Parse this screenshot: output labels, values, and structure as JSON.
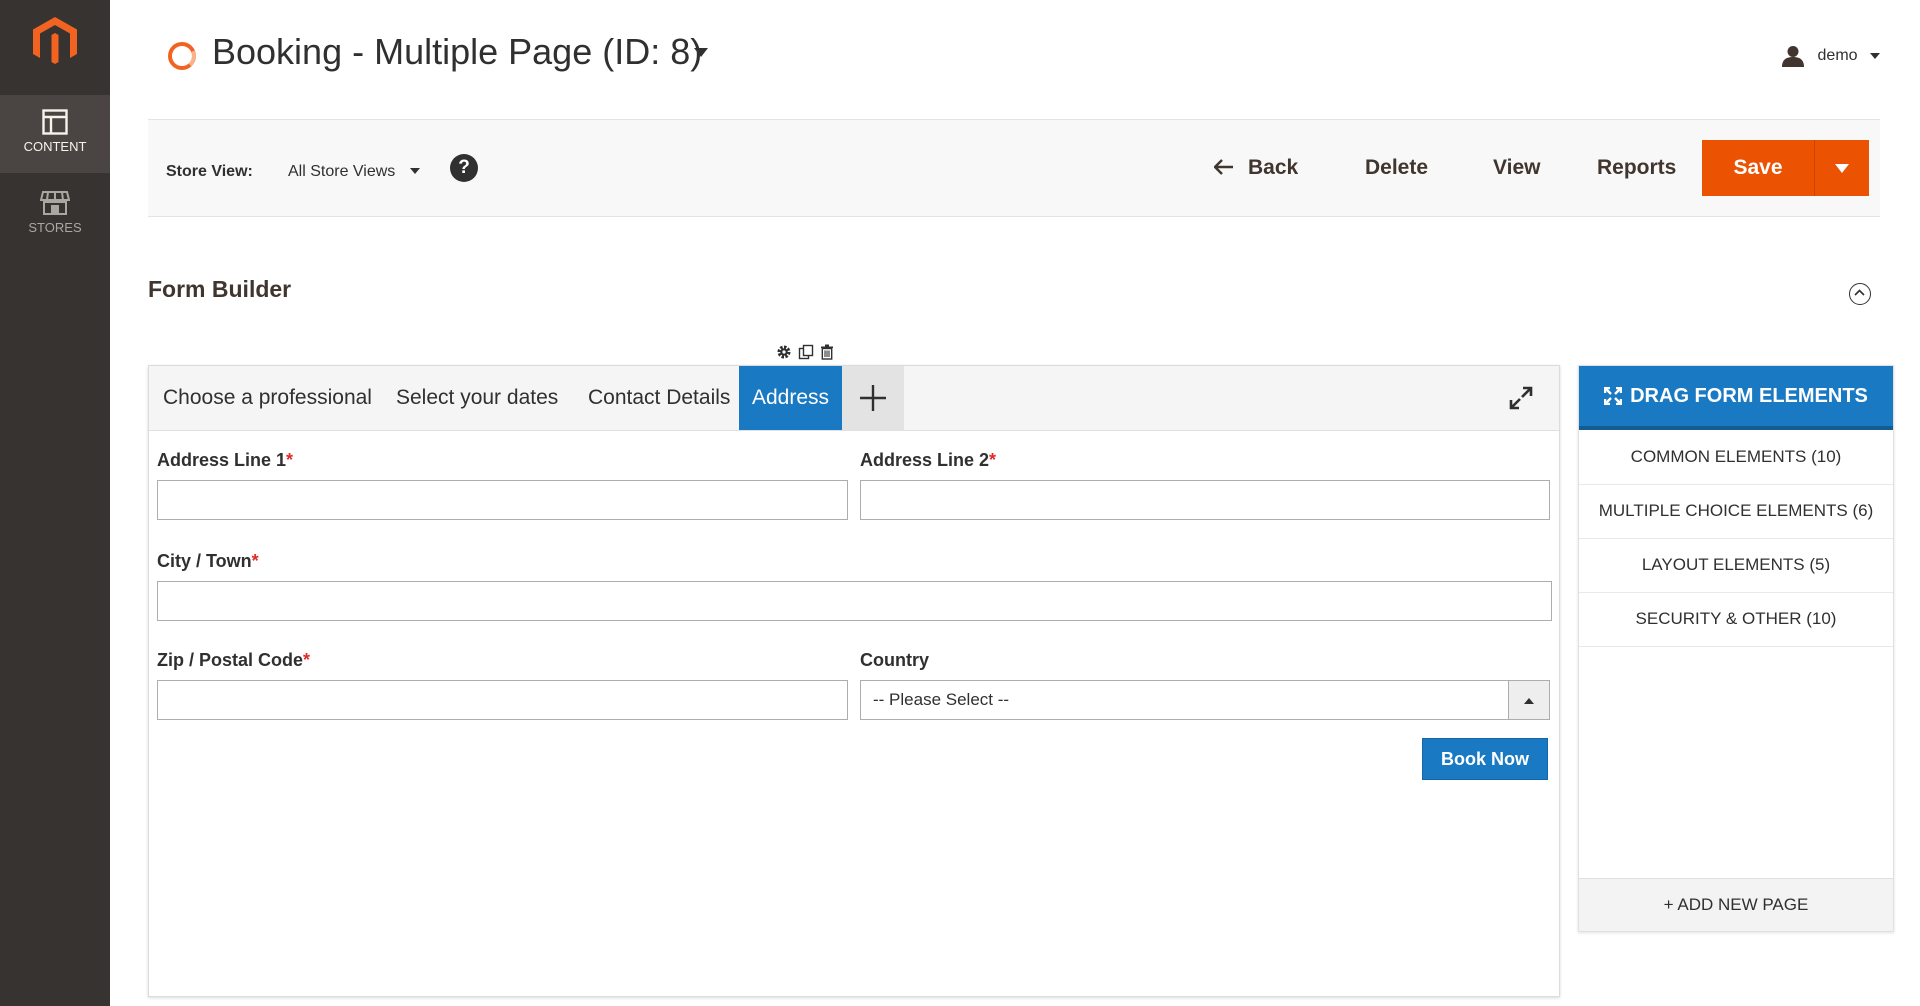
{
  "sidebar": {
    "items": [
      {
        "label": "CONTENT",
        "icon": "content-icon",
        "active": true
      },
      {
        "label": "STORES",
        "icon": "stores-icon",
        "active": false
      }
    ]
  },
  "header": {
    "title": "Booking - Multiple Page (ID: 8)",
    "user": "demo"
  },
  "toolbar": {
    "store_view_label": "Store View:",
    "store_view_value": "All Store Views",
    "help": "?",
    "back": "Back",
    "delete": "Delete",
    "view": "View",
    "reports": "Reports",
    "save": "Save"
  },
  "section": {
    "title": "Form Builder"
  },
  "tabs": [
    {
      "label": "Choose a professional",
      "active": false
    },
    {
      "label": "Select your dates",
      "active": false
    },
    {
      "label": "Contact Details",
      "active": false
    },
    {
      "label": "Address",
      "active": true
    }
  ],
  "form": {
    "address1": {
      "label": "Address Line 1",
      "required": "*",
      "value": ""
    },
    "address2": {
      "label": "Address Line 2",
      "required": "*",
      "value": ""
    },
    "city": {
      "label": "City / Town",
      "required": "*",
      "value": ""
    },
    "zip": {
      "label": "Zip / Postal Code",
      "required": "*",
      "value": ""
    },
    "country": {
      "label": "Country",
      "selected": "-- Please Select --"
    },
    "submit": "Book Now"
  },
  "panel": {
    "header": "DRAG FORM ELEMENTS",
    "items": [
      "COMMON ELEMENTS (10)",
      "MULTIPLE CHOICE ELEMENTS (6)",
      "LAYOUT ELEMENTS (5)",
      "SECURITY & OTHER (10)"
    ],
    "add_page": "+ ADD NEW PAGE"
  },
  "colors": {
    "sidebar_bg": "#373330",
    "accent_orange": "#eb5202",
    "accent_blue": "#1979c3",
    "required": "#e02b27"
  }
}
